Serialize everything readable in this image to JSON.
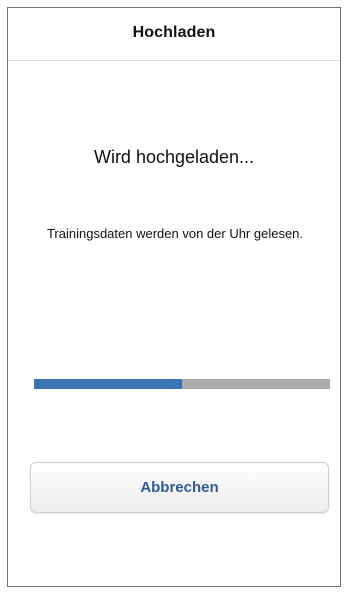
{
  "header": {
    "title": "Hochladen"
  },
  "status": {
    "title": "Wird hochgeladen...",
    "detail": "Trainingsdaten werden von der Uhr gelesen."
  },
  "progress": {
    "value_percent": 50,
    "fill_color": "#3a74b7",
    "track_color": "#aaaaab"
  },
  "actions": {
    "cancel_label": "Abbrechen",
    "cancel_text_color": "#2f5a9a"
  }
}
